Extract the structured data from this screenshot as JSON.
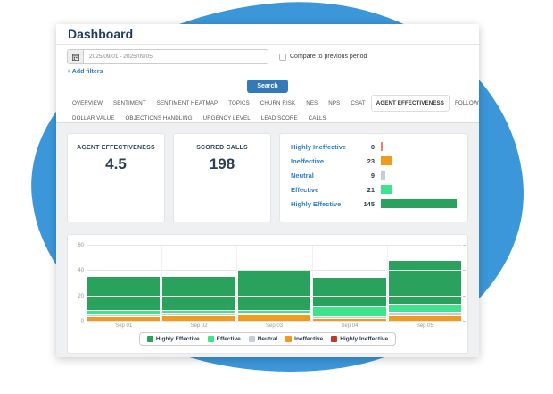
{
  "header": {
    "title": "Dashboard"
  },
  "filters": {
    "date_range": "2025/09/01 - 2025/09/05",
    "compare_label": "Compare to previous period",
    "compare_checked": false,
    "add_filters_label": "+ Add filters",
    "search_label": "Search"
  },
  "tabs": {
    "row1": [
      {
        "label": "OVERVIEW",
        "active": false
      },
      {
        "label": "SENTIMENT",
        "active": false
      },
      {
        "label": "SENTIMENT HEATMAP",
        "active": false
      },
      {
        "label": "TOPICS",
        "active": false
      },
      {
        "label": "CHURN RISK",
        "active": false
      },
      {
        "label": "NES",
        "active": false
      },
      {
        "label": "NPS",
        "active": false
      },
      {
        "label": "CSAT",
        "active": false
      },
      {
        "label": "AGENT EFFECTIVENESS",
        "active": true
      },
      {
        "label": "FOLLOW-UP COMMITMENT",
        "active": false
      }
    ],
    "row2": [
      {
        "label": "DOLLAR VALUE",
        "active": false
      },
      {
        "label": "OBJECTIONS HANDLING",
        "active": false
      },
      {
        "label": "URGENCY LEVEL",
        "active": false
      },
      {
        "label": "LEAD SCORE",
        "active": false
      },
      {
        "label": "CALLS",
        "active": false
      }
    ]
  },
  "cards": [
    {
      "label": "AGENT EFFECTIVENESS",
      "value": "4.5"
    },
    {
      "label": "SCORED CALLS",
      "value": "198"
    }
  ],
  "breakdown": {
    "max": 145,
    "rows": [
      {
        "label": "Highly Ineffective",
        "value": 0,
        "color": "#ef7f6a"
      },
      {
        "label": "Ineffective",
        "value": 23,
        "color": "#f09b1d"
      },
      {
        "label": "Neutral",
        "value": 9,
        "color": "#c7cdd3"
      },
      {
        "label": "Effective",
        "value": 21,
        "color": "#40e38b"
      },
      {
        "label": "Highly Effective",
        "value": 145,
        "color": "#2ba15e"
      }
    ]
  },
  "chart_data": {
    "type": "bar",
    "stacked": true,
    "categories": [
      "Sep 01",
      "Sep 02",
      "Sep 03",
      "Sep 04",
      "Sep 05"
    ],
    "series": [
      {
        "name": "Highly Effective",
        "color": "#2ba15e",
        "values": [
          27,
          27,
          33,
          23,
          35
        ]
      },
      {
        "name": "Effective",
        "color": "#40e38b",
        "values": [
          3,
          2,
          2,
          8,
          6
        ]
      },
      {
        "name": "Neutral",
        "color": "#c7cdd3",
        "values": [
          2,
          2,
          1,
          1,
          3
        ]
      },
      {
        "name": "Ineffective",
        "color": "#f09b1d",
        "values": [
          4,
          5,
          6,
          3,
          5
        ]
      },
      {
        "name": "Highly Ineffective",
        "color": "#c0392b",
        "values": [
          0,
          0,
          0,
          0,
          0
        ]
      }
    ],
    "totals_per_category": [
      36,
      36,
      42,
      35,
      49
    ],
    "ylim": [
      0,
      60
    ],
    "yticks": [
      0,
      20,
      40,
      60
    ],
    "grid": true,
    "legend_position": "bottom"
  },
  "colors": {
    "accent_blue": "#337ab7",
    "blob_blue": "#3b97d9",
    "title_navy": "#1d3e5e",
    "value_navy": "#2c3e50",
    "label_link_blue": "#2f80c3"
  }
}
